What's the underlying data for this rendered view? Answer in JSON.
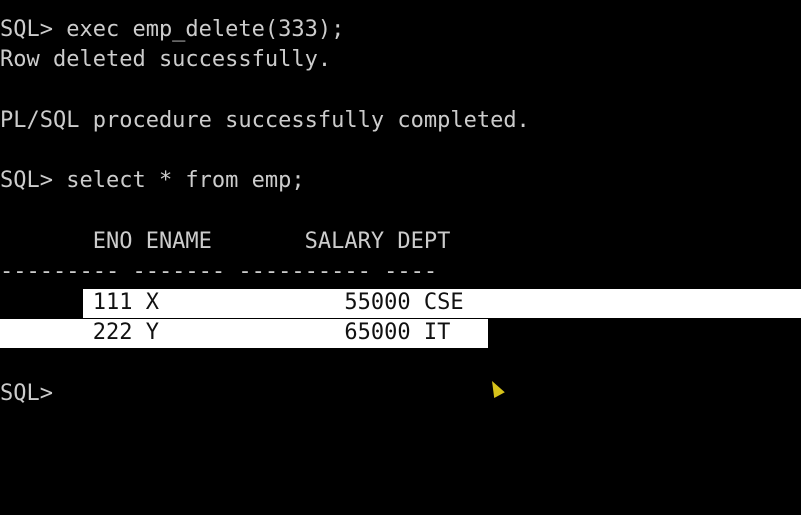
{
  "terminal": {
    "lines": [
      "SQL> exec emp_delete(333);",
      "Row deleted successfully.",
      "",
      "PL/SQL procedure successfully completed.",
      "",
      "SQL> select * from emp;",
      "",
      "       ENO ENAME       SALARY DEPT",
      "--------- ------- ---------- ----",
      "       111 X              55000 CSE",
      "       222 Y              65000 IT",
      "",
      "SQL>"
    ],
    "colors": {
      "background": "#000000",
      "text": "#cccccc",
      "highlight": "#ffffff",
      "highlight_text": "#111111"
    },
    "cursor_icon": "mouse-pointer-icon"
  }
}
